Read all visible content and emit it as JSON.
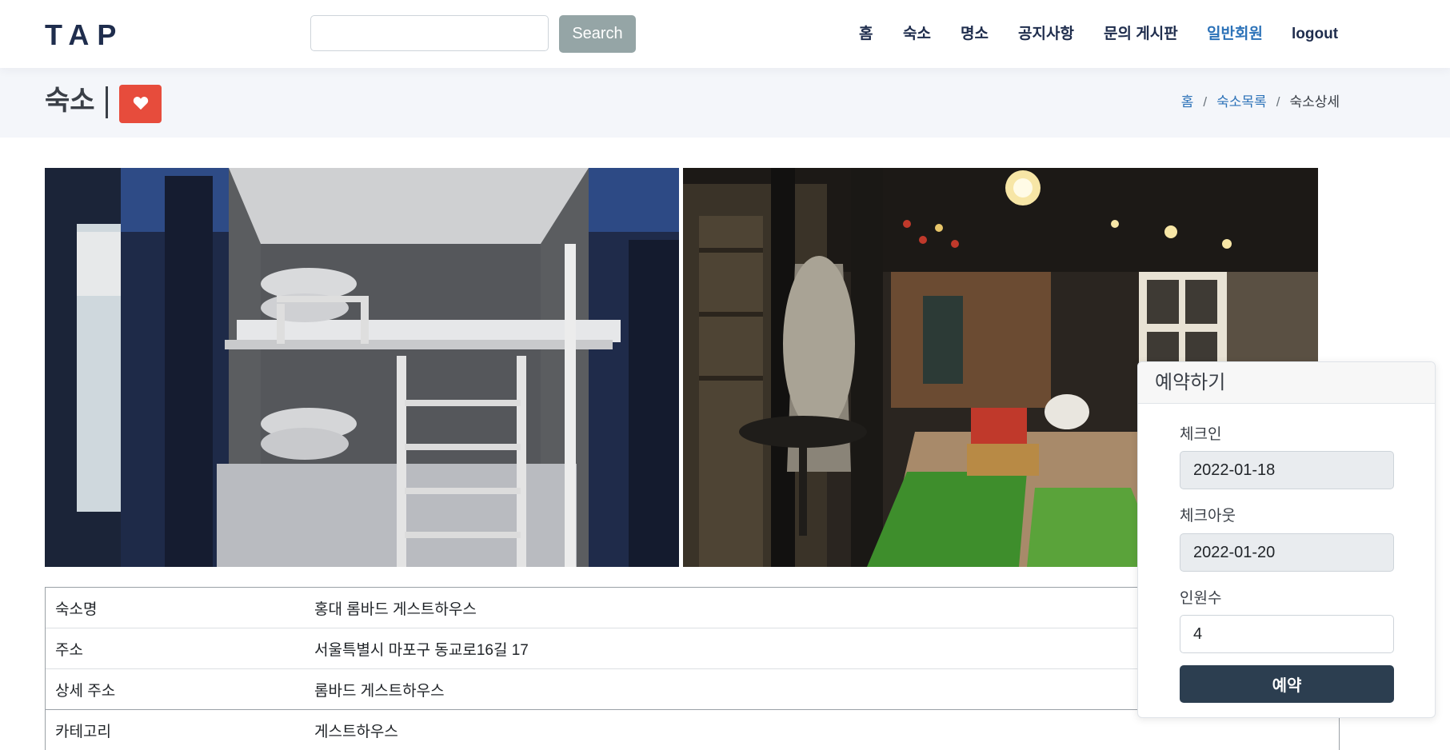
{
  "header": {
    "logo": "TAP",
    "search": {
      "value": "",
      "button_label": "Search"
    },
    "nav": [
      {
        "label": "홈"
      },
      {
        "label": "숙소"
      },
      {
        "label": "명소"
      },
      {
        "label": "공지사항"
      },
      {
        "label": "문의 게시판"
      },
      {
        "label": "일반회원"
      },
      {
        "label": "logout"
      }
    ]
  },
  "page": {
    "title": "숙소",
    "favorite_icon": "heart-icon",
    "breadcrumb": [
      {
        "label": "홈"
      },
      {
        "label": "숙소목록"
      },
      {
        "label": "숙소상세"
      }
    ]
  },
  "gallery": {
    "images": [
      {
        "subject": "bunk-bed-room-photo"
      },
      {
        "subject": "lounge-terrace-photo"
      }
    ]
  },
  "details": [
    {
      "label": "숙소명",
      "value": "홍대 롬바드 게스트하우스"
    },
    {
      "label": "주소",
      "value": "서울특별시 마포구 동교로16길 17"
    },
    {
      "label": "상세 주소",
      "value": "롬바드 게스트하우스"
    },
    {
      "label": "카테고리",
      "value": "게스트하우스"
    }
  ],
  "booking": {
    "title": "예약하기",
    "checkin": {
      "label": "체크인",
      "value": "2022-01-18"
    },
    "checkout": {
      "label": "체크아웃",
      "value": "2022-01-20"
    },
    "guests": {
      "label": "인원수",
      "value": "4"
    },
    "submit_label": "예약"
  },
  "colors": {
    "brand": "#1f2d4d",
    "active_nav": "#2c72b8",
    "heart_button": "#e74c3c",
    "search_button": "#95a5a6",
    "reserve_button": "#2c3e50"
  }
}
